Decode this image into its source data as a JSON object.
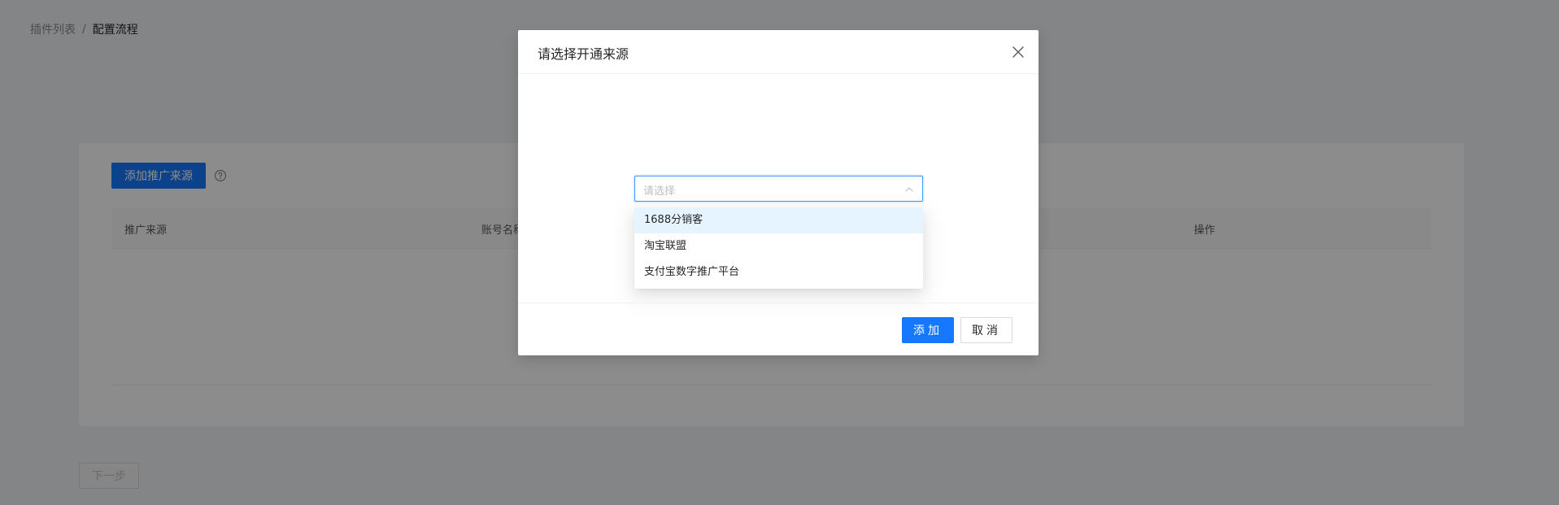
{
  "breadcrumb": {
    "items": [
      "插件列表",
      "配置流程"
    ],
    "separator": "/"
  },
  "toolbar": {
    "add_source_label": "添加推广来源",
    "help_icon": "question-circle-icon"
  },
  "table": {
    "columns": [
      "推广来源",
      "账号名称",
      "操作"
    ]
  },
  "footer": {
    "next_label": "下一步"
  },
  "modal": {
    "title": "请选择开通来源",
    "close_icon": "close-icon",
    "select": {
      "placeholder": "请选择",
      "options": [
        "1688分销客",
        "淘宝联盟",
        "支付宝数字推广平台"
      ],
      "active_index": 0
    },
    "ok_label": "添加",
    "cancel_label": "取消"
  },
  "colors": {
    "primary": "#1677ff",
    "active_option_bg": "#e6f4ff",
    "mask": "rgba(0,0,0,0.45)"
  }
}
